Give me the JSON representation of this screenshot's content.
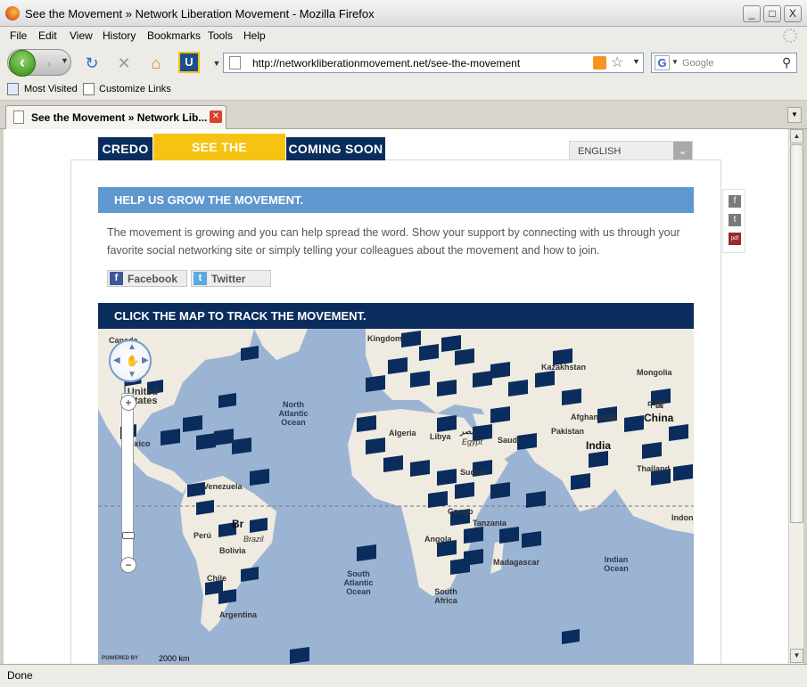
{
  "window": {
    "title": "See the Movement » Network Liberation Movement - Mozilla Firefox",
    "buttons": [
      "_",
      "□",
      "X"
    ]
  },
  "menu": [
    "File",
    "Edit",
    "View",
    "History",
    "Bookmarks",
    "Tools",
    "Help"
  ],
  "toolbar": {
    "url": "http://networkliberationmovement.net/see-the-movement",
    "search_placeholder": "Google",
    "search_engine_glyph": "G"
  },
  "bookmarks": [
    "Most Visited",
    "Customize Links"
  ],
  "tabs": [
    {
      "title": "See the Movement » Network Lib..."
    }
  ],
  "status": {
    "text": "Done"
  },
  "page": {
    "nav": [
      "CREDO",
      "SEE THE MOVEMENT",
      "COMING SOON"
    ],
    "active_nav": "SEE THE MOVEMENT",
    "language": "ENGLISH",
    "help_heading": "HELP US GROW THE MOVEMENT.",
    "intro": "The movement is growing and you can help spread the word. Show your support by connecting with us through your favorite social networking site or simply telling your colleagues about the movement and how to join.",
    "share": [
      {
        "label": "Facebook",
        "glyph": "f"
      },
      {
        "label": "Twitter",
        "glyph": "t"
      }
    ],
    "side_tools": [
      "f",
      "t",
      "pdf"
    ],
    "map_heading": "CLICK THE MAP TO TRACK THE MOVEMENT.",
    "map": {
      "labels": {
        "canada": "Canada",
        "united_states": "United States",
        "mexico": "Mexico",
        "venezuela": "Venezuela",
        "brazil_short": "Br",
        "brazil": "Brazil",
        "peru": "Perú",
        "bolivia": "Bolivia",
        "chile": "Chile",
        "argentina": "Argentina",
        "north_atlantic": "North Atlantic Ocean",
        "south_atlantic": "South Atlantic Ocean",
        "indian_ocean": "Indian Ocean",
        "south_africa": "South Africa",
        "kingdom": "Kingdom",
        "kazakhstan": "Kazakhstan",
        "mongolia": "Mongolia",
        "china": "China",
        "china_native": "中国",
        "algeria": "Algeria",
        "libya": "Libya",
        "egypt_native": "مصر",
        "egypt": "Egypt",
        "saudi": "Saudi",
        "afghanistan": "Afghanistan",
        "pakistan": "Pakistan",
        "india": "India",
        "thailand": "Thailand",
        "sudan": "Sudan",
        "congo": "Congo",
        "tanzania": "Tanzania",
        "angola": "Angola",
        "madagascar": "Madagascar",
        "indonesia_short": "Indon"
      },
      "powered_by": "POWERED BY",
      "scale": "2000 km"
    },
    "colors": {
      "navy": "#0b2d5e",
      "active_tab": "#f7c313",
      "help_bar": "#5f97cf",
      "ocean": "#9cb4d3",
      "land": "#efebe0",
      "flag": "#0b2d5e"
    }
  }
}
